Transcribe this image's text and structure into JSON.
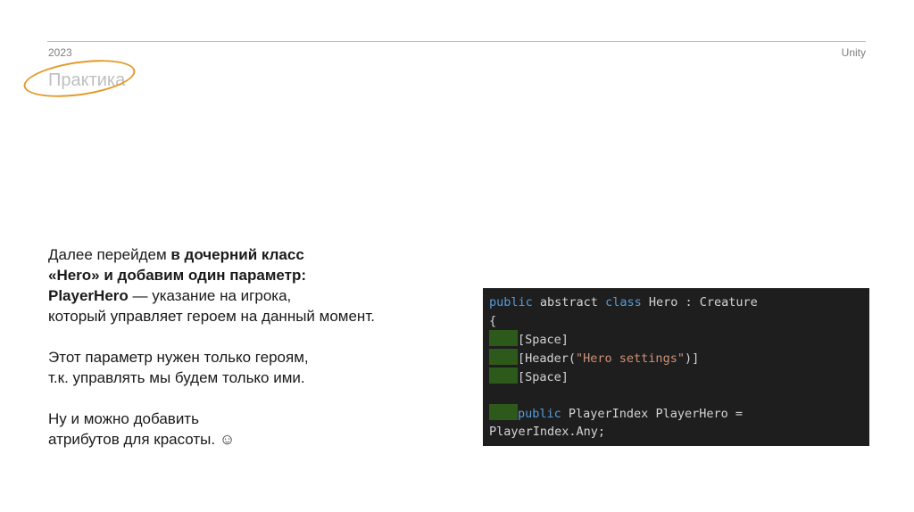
{
  "header": {
    "year": "2023",
    "brand": "Unity",
    "title": "Практика"
  },
  "body": {
    "p1": {
      "l1_a": "Далее перейдем ",
      "l1_b": "в дочерний класс",
      "l2": "«Hero» и добавим один параметр:",
      "l3_a": "PlayerHero",
      "l3_b": " — указание на игрока,",
      "l4": "который управляет героем на данный момент."
    },
    "p2": {
      "l1": "Этот параметр нужен только героям,",
      "l2": "т.к. управлять мы будем только ими."
    },
    "p3": {
      "l1": "Ну и можно добавить",
      "l2": "атрибутов для красоты. ☺"
    }
  },
  "code": {
    "line1": {
      "kw1": "public",
      "sp1": " abstract ",
      "kw2": "class",
      "rest": " Hero : Creature"
    },
    "line2": "{",
    "line3": "[Space]",
    "line4": {
      "a": "[Header(",
      "str": "\"Hero settings\"",
      "b": ")]"
    },
    "line5": "[Space]",
    "line7": {
      "kw": "public",
      "rest": " PlayerIndex PlayerHero ="
    },
    "line8": "PlayerIndex.Any;"
  },
  "colors": {
    "keyword": "#569cd6",
    "string": "#ce9178",
    "code_bg": "#1e1e1e",
    "indent_marker": "#2d5a1b",
    "highlight_oval": "#e39a2a"
  }
}
